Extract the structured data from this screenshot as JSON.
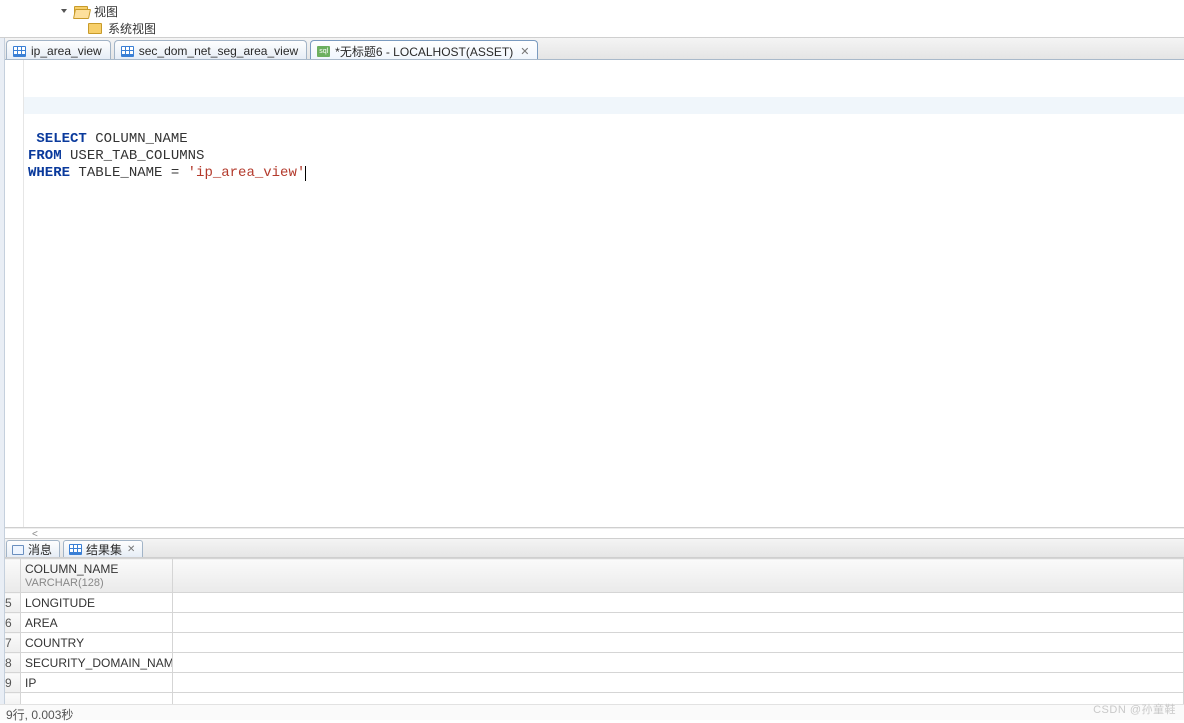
{
  "tree": {
    "node_label": "视图",
    "child_label": "系统视图"
  },
  "editor_tabs": {
    "tab1_label": "ip_area_view",
    "tab2_label": "sec_dom_net_seg_area_view",
    "tab3_label": "*无标题6 - LOCALHOST(ASSET)"
  },
  "sql": {
    "kw_select": "SELECT",
    "col": " COLUMN_NAME",
    "kw_from": "FROM",
    "from_tbl": " USER_TAB_COLUMNS",
    "kw_where": "WHERE",
    "where_expr": " TABLE_NAME = ",
    "where_lit": "'ip_area_view'"
  },
  "result_tabs": {
    "msg_label": "消息",
    "grid_label": "结果集"
  },
  "grid": {
    "header_name": "COLUMN_NAME",
    "header_type": "VARCHAR(128)",
    "rows": {
      "r1_num": "5",
      "r1_val": "LONGITUDE",
      "r2_num": "6",
      "r2_val": "AREA",
      "r3_num": "7",
      "r3_val": "COUNTRY",
      "r4_num": "8",
      "r4_val": "SECURITY_DOMAIN_NAME",
      "r5_num": "9",
      "r5_val": "IP"
    }
  },
  "status": "9行, 0.003秒",
  "watermark": "CSDN @孙童鞋"
}
